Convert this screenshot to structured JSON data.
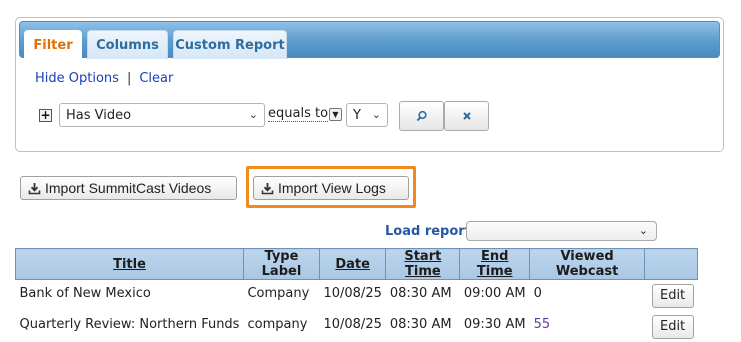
{
  "tabs": [
    {
      "label": "Filter",
      "active": true
    },
    {
      "label": "Columns",
      "active": false
    },
    {
      "label": "Custom Report",
      "active": false
    }
  ],
  "filter": {
    "hide_options": "Hide Options",
    "separator": "|",
    "clear": "Clear",
    "field_value": "Has Video",
    "operator": "equals to",
    "value": "Y",
    "add_icon": "plus-box-icon",
    "search_icon": "magnifier-icon",
    "clear_icon": "x-icon"
  },
  "actions": {
    "import_summitcast": "Import SummitCast Videos",
    "import_view_logs": "Import View Logs",
    "download_icon": "download-icon",
    "highlight_color": "#f08a1c"
  },
  "load_report": {
    "label": "Load report:",
    "value": ""
  },
  "grid": {
    "headers": [
      "Title",
      "Type Label",
      "Date",
      "Start Time",
      "End Time",
      "Viewed Webcast",
      ""
    ],
    "rows": [
      {
        "title": "Bank of New Mexico",
        "type_label": "Company",
        "date": "10/08/25",
        "start": "08:30 AM",
        "end": "09:00 AM",
        "viewed": "0",
        "edit": "Edit"
      },
      {
        "title": "Quarterly Review: Northern Funds",
        "type_label": "company",
        "date": "10/08/25",
        "start": "08:30 AM",
        "end": "09:30 AM",
        "viewed": "55",
        "edit": "Edit"
      }
    ]
  },
  "colors": {
    "tab_bar": "#5c9ccc",
    "active_tab_text": "#e17009",
    "link": "#1b3fb5",
    "header_bg": "#a9c7e4"
  }
}
